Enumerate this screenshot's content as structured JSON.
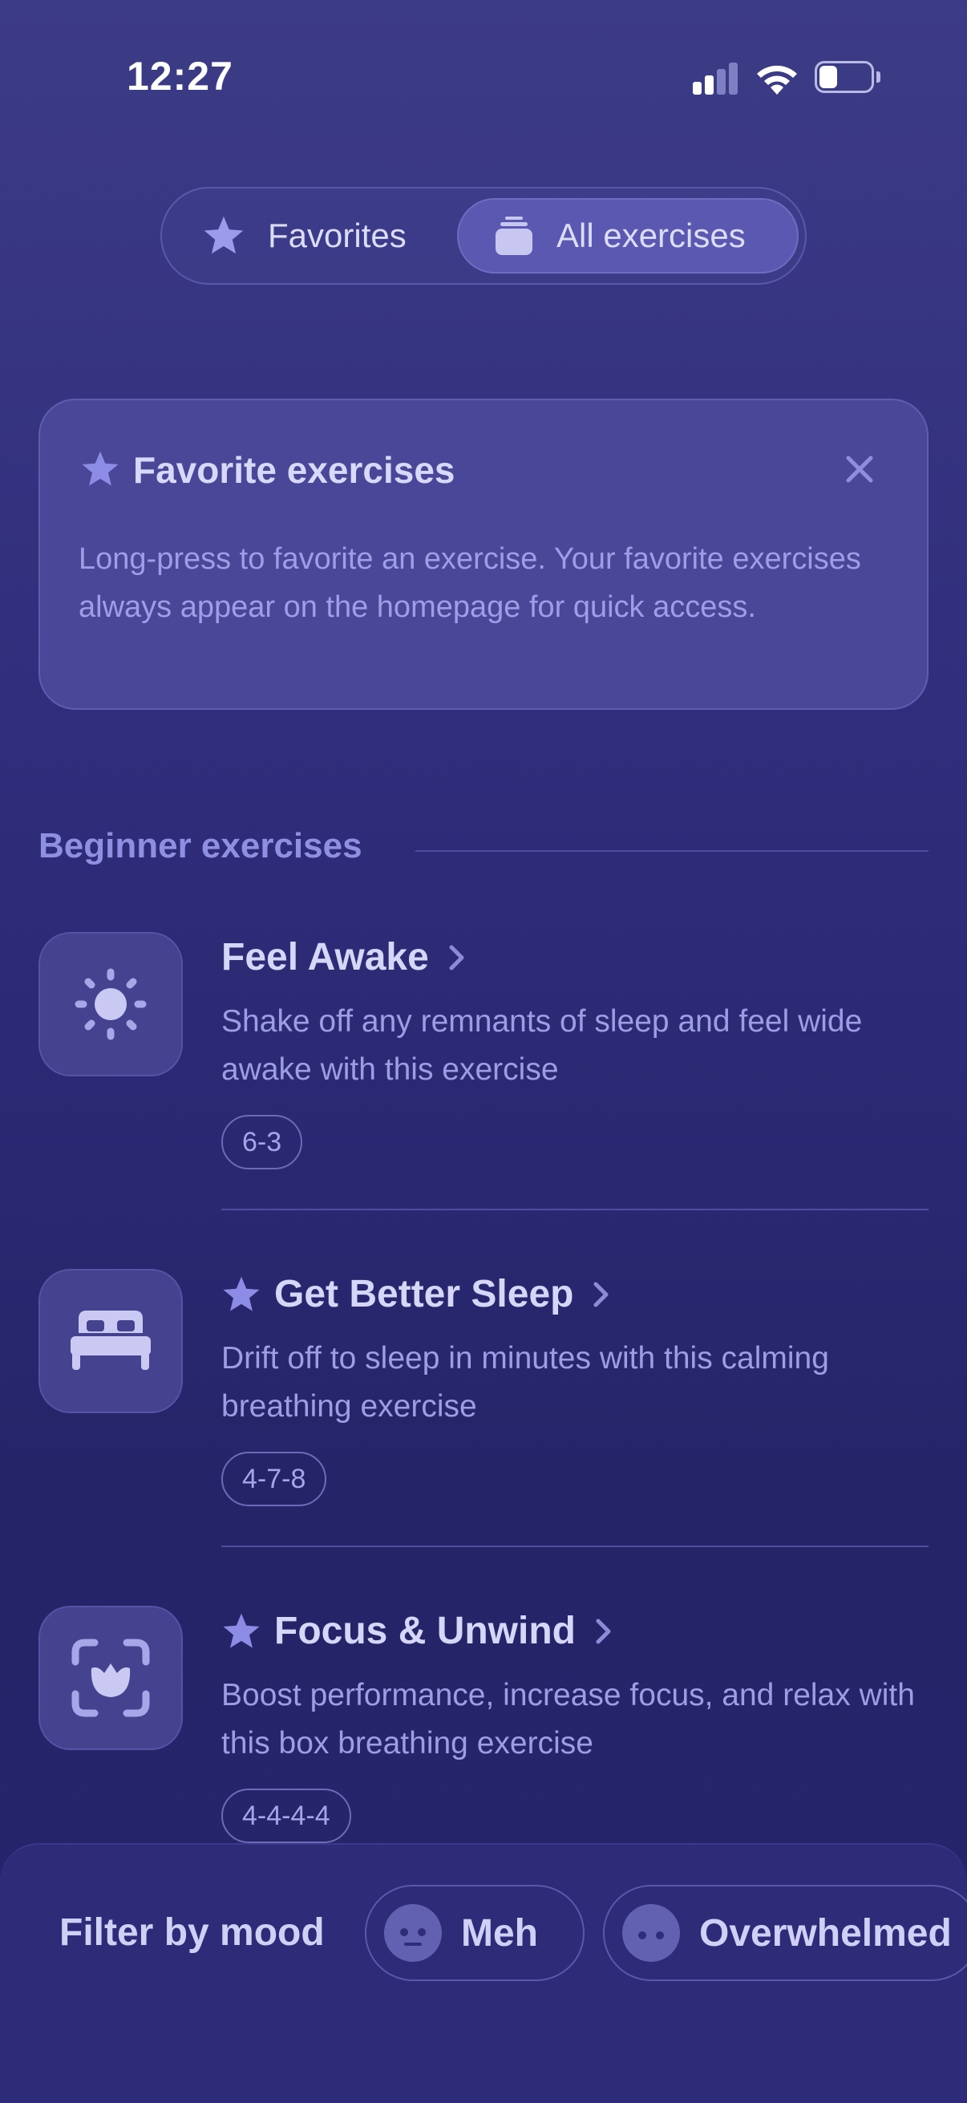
{
  "status_bar": {
    "time": "12:27"
  },
  "segmented": {
    "favorites_label": "Favorites",
    "all_label": "All exercises",
    "selected": "All exercises"
  },
  "favorite_card": {
    "title": "Favorite exercises",
    "description": "Long-press to favorite an exercise. Your favorite exercises always appear on the homepage for quick access."
  },
  "section": {
    "title": "Beginner exercises"
  },
  "exercises": [
    {
      "title": "Feel Awake",
      "favorite": false,
      "icon": "sun-icon",
      "description": "Shake off any remnants of sleep and feel wide awake with this exercise",
      "pattern": "6-3"
    },
    {
      "title": "Get Better Sleep",
      "favorite": true,
      "icon": "bed-icon",
      "description": "Drift off to sleep in minutes with this calming breathing exercise",
      "pattern": "4-7-8"
    },
    {
      "title": "Focus & Unwind",
      "favorite": true,
      "icon": "focus-lotus-icon",
      "description": "Boost performance, increase focus, and relax with this box breathing exercise",
      "pattern": "4-4-4-4"
    }
  ],
  "filter": {
    "label": "Filter by mood",
    "moods": [
      {
        "label": "Meh",
        "icon": "meh-face-icon"
      },
      {
        "label": "Overwhelmed",
        "icon": "overwhelmed-face-icon"
      }
    ]
  },
  "colors": {
    "background_top": "#3c3b86",
    "background_bottom": "#25236a",
    "accent": "#8f8fe2",
    "card": "#4a4798"
  }
}
